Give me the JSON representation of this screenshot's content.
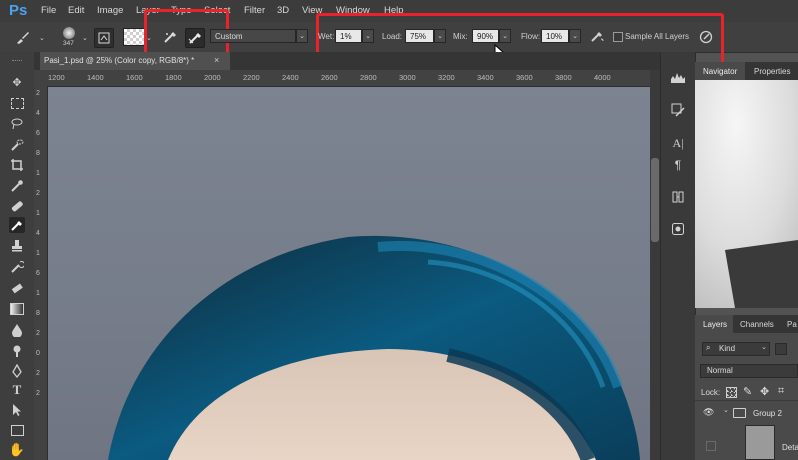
{
  "app": {
    "logo": "Ps"
  },
  "menu": [
    "File",
    "Edit",
    "Image",
    "Layer",
    "Type",
    "Select",
    "Filter",
    "3D",
    "View",
    "Window",
    "Help"
  ],
  "options": {
    "brush_size": "347",
    "preset": "Custom",
    "wet_label": "Wet:",
    "wet_value": "1%",
    "load_label": "Load:",
    "load_value": "75%",
    "mix_label": "Mix:",
    "mix_value": "90%",
    "flow_label": "Flow:",
    "flow_value": "10%",
    "sample_all_layers": "Sample All Layers"
  },
  "document": {
    "tab_label": "Pasi_1.psd @ 25% (Color copy, RGB/8*) *",
    "close": "×"
  },
  "ruler": {
    "top": [
      "1200",
      "1400",
      "1600",
      "1800",
      "2000",
      "2200",
      "2400",
      "2600",
      "2800",
      "3000",
      "3200",
      "3400",
      "3600",
      "3800",
      "4000"
    ],
    "left": [
      "2",
      "4",
      "6",
      "8",
      "1",
      "2",
      "1",
      "4",
      "1",
      "6",
      "1",
      "8",
      "2",
      "0",
      "2",
      "2"
    ]
  },
  "panels": {
    "navigator_tab": "Navigator",
    "properties_tab": "Properties",
    "layers_tab": "Layers",
    "channels_tab": "Channels",
    "paths_tab": "Pa",
    "filter_kind": "Kind",
    "blend_mode": "Normal",
    "lock_label": "Lock:",
    "group_name": "Group 2",
    "layer_partial": "Deta"
  },
  "colors": {
    "highlight": "#e8242a",
    "logo": "#4aa3f0"
  }
}
